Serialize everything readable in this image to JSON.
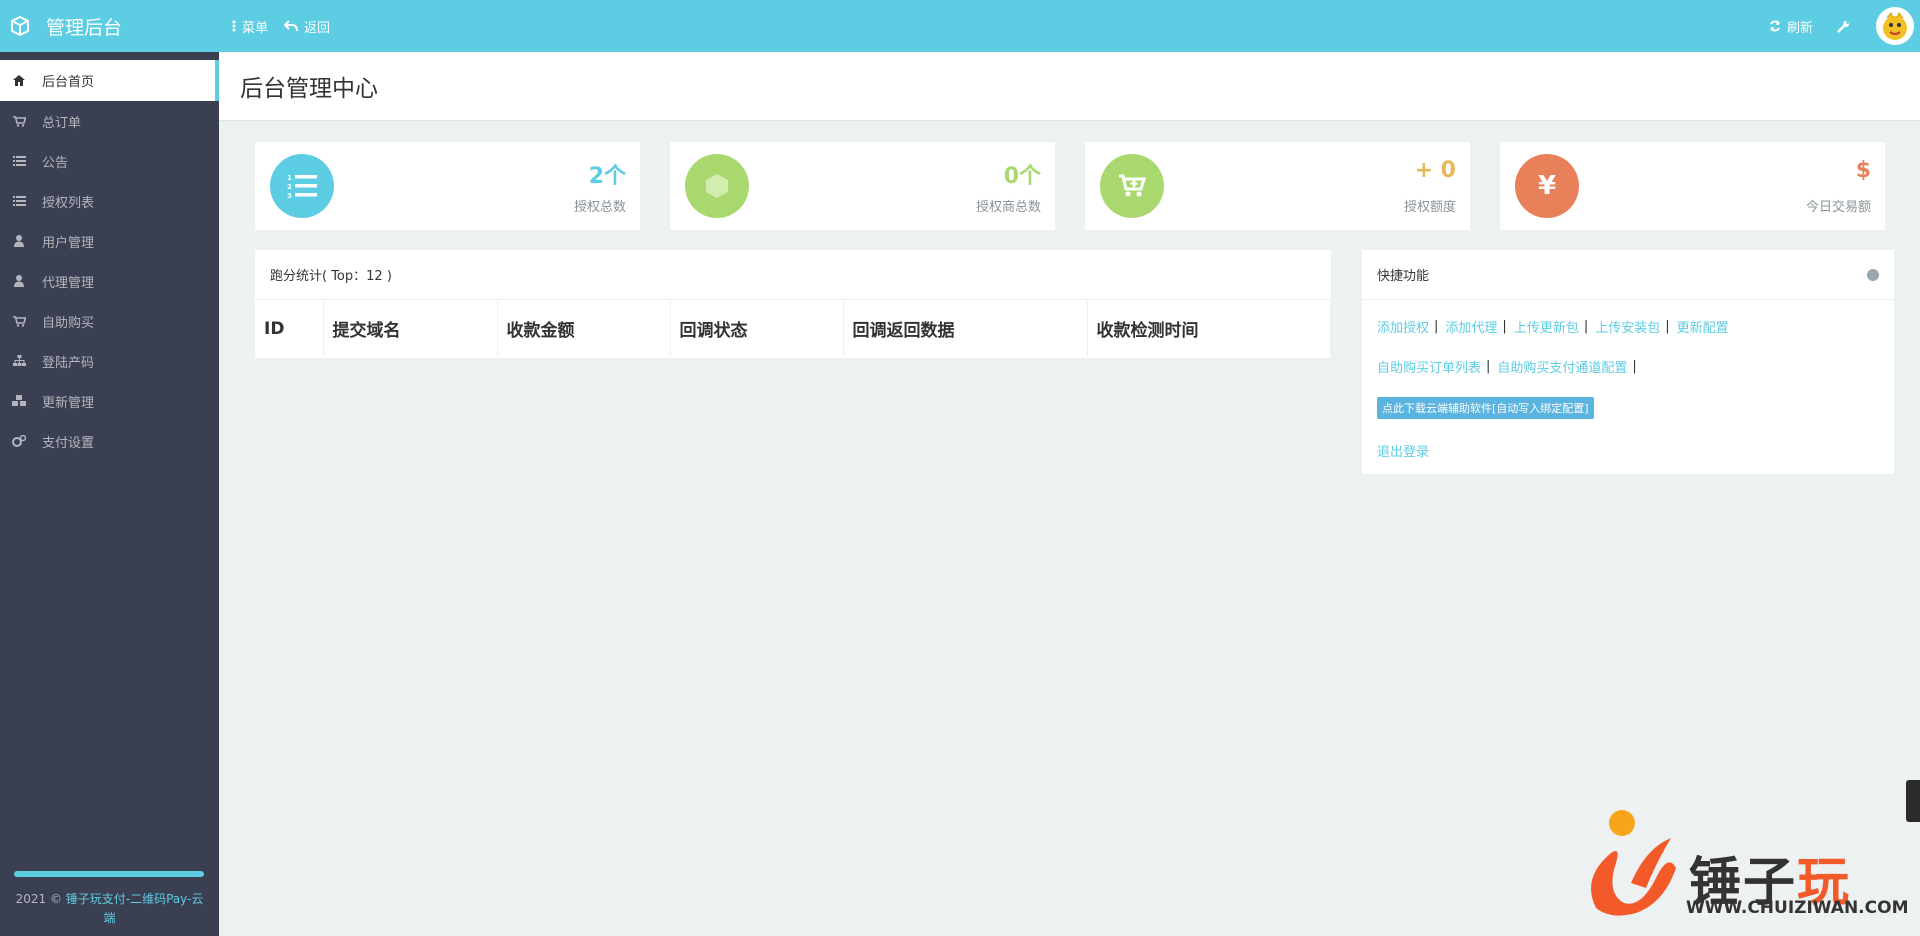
{
  "header": {
    "brand": "管理后台",
    "menu_label": "菜单",
    "back_label": "返回",
    "refresh_label": "刷新"
  },
  "sidebar": {
    "items": [
      {
        "label": "后台首页",
        "icon": "home-icon"
      },
      {
        "label": "总订单",
        "icon": "cart-icon"
      },
      {
        "label": "公告",
        "icon": "list-icon"
      },
      {
        "label": "授权列表",
        "icon": "list-icon"
      },
      {
        "label": "用户管理",
        "icon": "user-icon"
      },
      {
        "label": "代理管理",
        "icon": "user-icon"
      },
      {
        "label": "自助购买",
        "icon": "cart-icon"
      },
      {
        "label": "登陆产码",
        "icon": "sitemap-icon"
      },
      {
        "label": "更新管理",
        "icon": "cubes-icon"
      },
      {
        "label": "支付设置",
        "icon": "cogs-icon"
      }
    ],
    "footer_prefix": "2021 ©",
    "footer_link": "锤子玩支付-二维码Pay-云端"
  },
  "page": {
    "title": "后台管理中心"
  },
  "stats": [
    {
      "value": "2个",
      "label": "授权总数",
      "color": "#5dcde3",
      "icon": "ordered-list-icon"
    },
    {
      "value": "0个",
      "label": "授权商总数",
      "color": "#a9d86e",
      "icon": "hexagon-icon"
    },
    {
      "value": "+ 0",
      "label": "授权额度",
      "color": "#a9d86e",
      "num_color": "#e8b95a",
      "icon": "cart-plus-icon"
    },
    {
      "value": "$",
      "label": "今日交易额",
      "color": "#e8815a",
      "icon": "yen-icon",
      "icon_text": "¥"
    }
  ],
  "stats_panel": {
    "title": "跑分统计( Top：12 )",
    "columns": [
      "ID",
      "提交域名",
      "收款金额",
      "回调状态",
      "回调返回数据",
      "收款检测时间"
    ]
  },
  "quick": {
    "title": "快捷功能",
    "row1": [
      "添加授权",
      "添加代理",
      "上传更新包",
      "上传安装包",
      "更新配置"
    ],
    "row2": [
      "自助购买订单列表",
      "自助购买支付通道配置"
    ],
    "download_label": "点此下载云端辅助软件[自动写入绑定配置]",
    "logout_label": "退出登录"
  },
  "watermark": {
    "text_a": "锤子",
    "text_b": "玩",
    "url": "WWW.CHUIZIWAN.COM"
  }
}
